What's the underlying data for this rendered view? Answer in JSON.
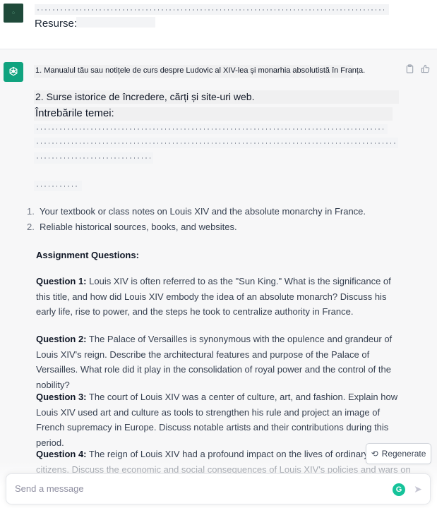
{
  "user_message": {
    "resources_label": "Resurse:"
  },
  "assistant_message": {
    "ro_lines": [
      "1. Manualul tău sau notițele de curs despre Ludovic al XIV-lea și monarhia absolutistă în Franța.",
      "2. Surse istorice de încredere, cărți și site-uri web.",
      "Întrebările temei:"
    ],
    "resources": [
      {
        "num": "1.",
        "text": "Your textbook or class notes on Louis XIV and the absolute monarchy in France."
      },
      {
        "num": "2.",
        "text": "Reliable historical sources, books, and websites."
      }
    ],
    "assignment_heading": "Assignment Questions:",
    "questions": [
      {
        "label": "Question 1:",
        "text": "Louis XIV is often referred to as the \"Sun King.\" What is the significance of this title, and how did Louis XIV embody the idea of an absolute monarch? Discuss his early life, rise to power, and the steps he took to centralize authority in France."
      },
      {
        "label": "Question 2:",
        "text": "The Palace of Versailles is synonymous with the opulence and grandeur of Louis XIV's reign. Describe the architectural features and purpose of the Palace of Versailles. What role did it play in the consolidation of royal power and the control of the nobility?"
      },
      {
        "label": "Question 3:",
        "text": "The court of Louis XIV was a center of culture, art, and fashion. Explain how Louis XIV used art and culture as tools to strengthen his rule and project an image of French supremacy in Europe. Discuss notable artists and their contributions during this period."
      },
      {
        "label": "Question 4:",
        "text": "The reign of Louis XIV had a profound impact on the lives of ordinary French citizens. Discuss the economic and social consequences of Louis XIV's policies and wars on"
      }
    ]
  },
  "regenerate_label": "Regenerate",
  "composer": {
    "placeholder": "Send a message"
  },
  "icons": {
    "copy": "clipboard-icon",
    "like": "thumbs-up-icon",
    "regenerate": "refresh-icon",
    "grammarly": "grammarly-icon",
    "send": "send-icon"
  },
  "colors": {
    "brand": "#10a37f",
    "user_avatar": "#1f4a3a",
    "grammarly": "#15c39a"
  }
}
